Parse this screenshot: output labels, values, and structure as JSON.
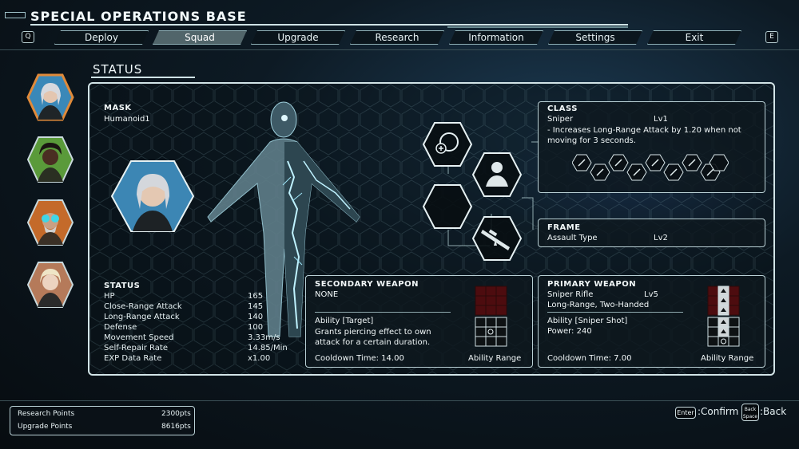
{
  "header": {
    "title": "SPECIAL OPERATIONS BASE"
  },
  "nav": {
    "left_key": "Q",
    "right_key": "E",
    "tabs": [
      {
        "label": "Deploy",
        "active": false
      },
      {
        "label": "Squad",
        "active": true
      },
      {
        "label": "Upgrade",
        "active": false
      },
      {
        "label": "Research",
        "active": false
      },
      {
        "label": "Information",
        "active": false
      },
      {
        "label": "Settings",
        "active": false
      },
      {
        "label": "Exit",
        "active": false
      }
    ]
  },
  "status": {
    "header": "STATUS",
    "mask_label": "MASK",
    "mask_value": "Humanoid1",
    "stats_header": "STATUS",
    "stats": [
      {
        "label": "HP",
        "value": "165"
      },
      {
        "label": "Close-Range Attack",
        "value": "145"
      },
      {
        "label": "Long-Range Attack",
        "value": "140"
      },
      {
        "label": "Defense",
        "value": "100"
      },
      {
        "label": "Movement Speed",
        "value": "3.33m/s"
      },
      {
        "label": "Self-Repair Rate",
        "value": "14.85/Min"
      },
      {
        "label": "EXP Data Rate",
        "value": "x1.00"
      }
    ]
  },
  "class_panel": {
    "title": "CLASS",
    "name": "Sniper",
    "level": "Lv1",
    "description": "- Increases Long-Range Attack by 1.20 when not moving for 3 seconds."
  },
  "frame_panel": {
    "title": "FRAME",
    "type": "Assault Type",
    "level": "Lv2"
  },
  "secondary_weapon": {
    "title": "SECONDARY WEAPON",
    "name": "NONE",
    "ability": "Ability [Target]",
    "ability_desc": "Grants piercing effect to own attack for a certain duration.",
    "cooldown": "Cooldown Time: 14.00",
    "range_label": "Ability Range"
  },
  "primary_weapon": {
    "title": "PRIMARY WEAPON",
    "name": "Sniper Rifle",
    "level": "Lv5",
    "traits": "Long-Range, Two-Handed",
    "ability": "Ability [Sniper Shot]",
    "power": "Power: 240",
    "cooldown": "Cooldown Time: 7.00",
    "range_label": "Ability Range"
  },
  "points": {
    "research_label": "Research Points",
    "research_value": "2300pts",
    "upgrade_label": "Upgrade Points",
    "upgrade_value": "8616pts"
  },
  "controls": {
    "confirm_key": "Enter",
    "confirm_label": ":Confirm",
    "back_key": "Back Space",
    "back_label": ":Back"
  },
  "colors": {
    "accent": "#d2e4e7",
    "selected_portrait_border": "#e08a3a",
    "range_grid_red": "#5a0d10"
  }
}
